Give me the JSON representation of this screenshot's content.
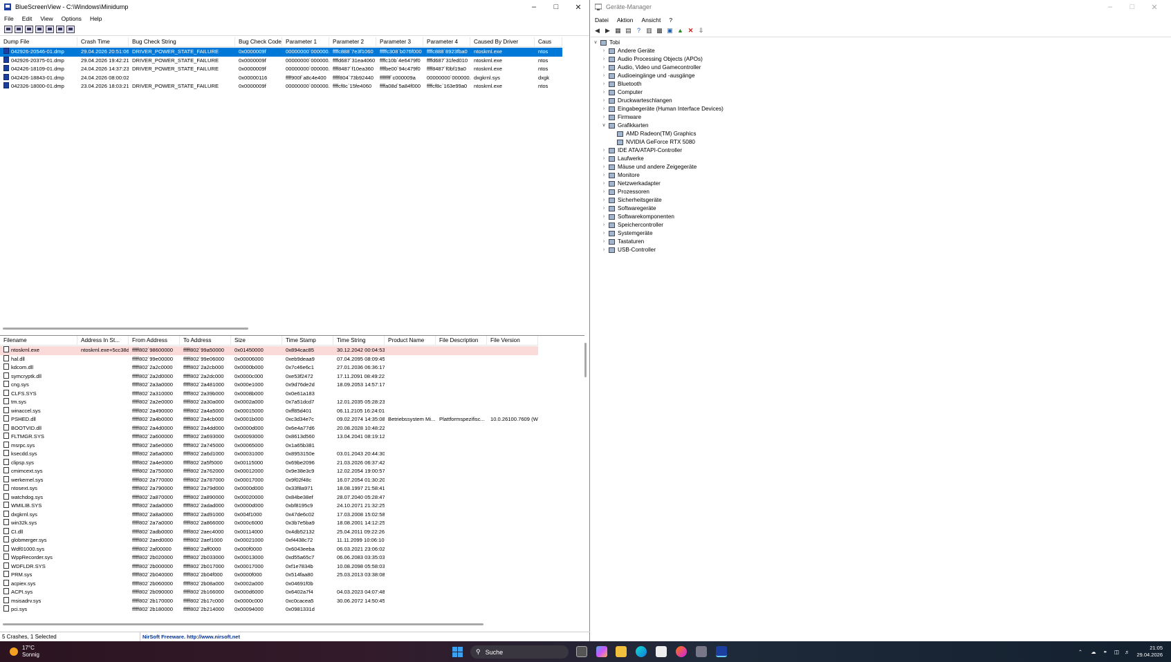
{
  "bsv": {
    "title": "BlueScreenView  -  C:\\Windows\\Minidump",
    "menu": [
      "File",
      "Edit",
      "View",
      "Options",
      "Help"
    ],
    "upper_columns": [
      "Dump File",
      "Crash Time",
      "Bug Check String",
      "Bug Check Code",
      "Parameter 1",
      "Parameter 2",
      "Parameter 3",
      "Parameter 4",
      "Caused By Driver",
      "Caus"
    ],
    "crashes": [
      [
        "042926-20546-01.dmp",
        "29.04.2026 20:51:06",
        "DRIVER_POWER_STATE_FAILURE",
        "0x0000009f",
        "00000000`000000...",
        "ffffc888`7e3f1060",
        "fffffc308`b076f000",
        "ffffc888`8923fba0",
        "ntoskrnl.exe",
        "ntos"
      ],
      [
        "042926-20375-01.dmp",
        "29.04.2026 19:42:21",
        "DRIVER_POWER_STATE_FAILURE",
        "0x0000009f",
        "00000000`000000...",
        "ffffd687`31ea4060",
        "ffffc10b`4e6479f0",
        "ffffd687`31fed010",
        "ntoskrnl.exe",
        "ntos"
      ],
      [
        "042426-18109-01.dmp",
        "24.04.2026 14:37:23",
        "DRIVER_POWER_STATE_FAILURE",
        "0x0000009f",
        "00000000`000000...",
        "ffff8487`f10ea360",
        "ffffbe00`94c479f0",
        "ffff8487`f0bf19a0",
        "ntoskrnl.exe",
        "ntos"
      ],
      [
        "042426-18843-01.dmp",
        "24.04.2026 08:00:02",
        "",
        "0x00000116",
        "ffff900f`a8c4e400",
        "fffff804`73b92440",
        "ffffffff`c000009a",
        "00000000`000000...",
        "dxgkrnl.sys",
        "dxgk"
      ],
      [
        "042326-18000-01.dmp",
        "23.04.2026 18:03:21",
        "DRIVER_POWER_STATE_FAILURE",
        "0x0000009f",
        "00000000`000000...",
        "ffffcf8c`15fe4060",
        "ffffa08d`5a84f000",
        "ffffcf8c`163e99a0",
        "ntoskrnl.exe",
        "ntos"
      ]
    ],
    "lower_columns": [
      "Filename",
      "Address In St...",
      "From Address",
      "To Address",
      "Size",
      "Time Stamp",
      "Time String",
      "Product Name",
      "File Description",
      "File Version"
    ],
    "modules": [
      [
        "ntoskrnl.exe",
        "ntoskrnl.exe+5cc38d",
        "fffff802`98600000",
        "fffff802`99a50000",
        "0x01450000",
        "0x894cac85",
        "30.12.2042 00:04:53",
        "",
        "",
        ""
      ],
      [
        "hal.dll",
        "",
        "fffff802`99e00000",
        "fffff802`99e06000",
        "0x00006000",
        "0xeb9deaa9",
        "07.04.2095 08:09:45",
        "",
        "",
        ""
      ],
      [
        "kdcom.dll",
        "",
        "fffff802`2a2c0000",
        "fffff802`2a2cb000",
        "0x0000b000",
        "0x7c46e6c1",
        "27.01.2036 06:36:17",
        "",
        "",
        ""
      ],
      [
        "symcryptk.dll",
        "",
        "fffff802`2a2d0000",
        "fffff802`2a2dc000",
        "0x0000c000",
        "0xe53f2472",
        "17.11.2091 08:49:22",
        "",
        "",
        ""
      ],
      [
        "cng.sys",
        "",
        "fffff802`2a3a0000",
        "fffff802`2a481000",
        "0x000e1000",
        "0x9d76de2d",
        "18.09.2053 14:57:17",
        "",
        "",
        ""
      ],
      [
        "CLFS.SYS",
        "",
        "fffff802`2a310000",
        "fffff802`2a39b000",
        "0x0008b000",
        "0x0e61a183",
        "",
        "",
        "",
        ""
      ],
      [
        "tm.sys",
        "",
        "fffff802`2a2e0000",
        "fffff802`2a30a000",
        "0x0002a000",
        "0x7a51dcd7",
        "12.01.2035 05:28:23",
        "",
        "",
        ""
      ],
      [
        "winaccel.sys",
        "",
        "fffff802`2a490000",
        "fffff802`2a4a5000",
        "0x00015000",
        "0xff85d401",
        "06.11.2105 16:24:01",
        "",
        "",
        ""
      ],
      [
        "PSHED.dll",
        "",
        "fffff802`2a4b0000",
        "fffff802`2a4cb000",
        "0x0001b000",
        "0xc3d34e7c",
        "09.02.2074 14:35:08",
        "Betriebssystem Mi...",
        "Plattformspezifisc...",
        "10.0.26100.7609 (W..."
      ],
      [
        "BOOTVID.dll",
        "",
        "fffff802`2a4d0000",
        "fffff802`2a4dd000",
        "0x0000d000",
        "0x6e4a77d6",
        "20.08.2028 10:48:22",
        "",
        "",
        ""
      ],
      [
        "FLTMGR.SYS",
        "",
        "fffff802`2a600000",
        "fffff802`2a693000",
        "0x00093000",
        "0x8613d560",
        "13.04.2041 08:19:12",
        "",
        "",
        ""
      ],
      [
        "msrpc.sys",
        "",
        "fffff802`2a6e0000",
        "fffff802`2a745000",
        "0x00065000",
        "0x1a65b381",
        "",
        "",
        "",
        ""
      ],
      [
        "ksecdd.sys",
        "",
        "fffff802`2a6a0000",
        "fffff802`2a6d1000",
        "0x00031000",
        "0x8953150e",
        "03.01.2043 20:44:30",
        "",
        "",
        ""
      ],
      [
        "clipsp.sys",
        "",
        "fffff802`2a4e0000",
        "fffff802`2a5f5000",
        "0x00115000",
        "0x69be2096",
        "21.03.2026 06:37:42",
        "",
        "",
        ""
      ],
      [
        "cmimcext.sys",
        "",
        "fffff802`2a750000",
        "fffff802`2a762000",
        "0x00012000",
        "0x9e38e3c9",
        "12.02.2054 19:00:57",
        "",
        "",
        ""
      ],
      [
        "werkernel.sys",
        "",
        "fffff802`2a770000",
        "fffff802`2a787000",
        "0x00017000",
        "0x9f02f48c",
        "16.07.2054 01:30:20",
        "",
        "",
        ""
      ],
      [
        "ntosext.sys",
        "",
        "fffff802`2a790000",
        "fffff802`2a79d000",
        "0x0000d000",
        "0x33f8a971",
        "18.08.1997 21:58:41",
        "",
        "",
        ""
      ],
      [
        "watchdog.sys",
        "",
        "fffff802`2a870000",
        "fffff802`2a890000",
        "0x00020000",
        "0x84be38ef",
        "28.07.2040 05:28:47",
        "",
        "",
        ""
      ],
      [
        "WMILIB.SYS",
        "",
        "fffff802`2ada0000",
        "fffff802`2adad000",
        "0x0000d000",
        "0xbf8195c9",
        "24.10.2071 21:32:25",
        "",
        "",
        ""
      ],
      [
        "dxgkrnl.sys",
        "",
        "fffff802`2a8a0000",
        "fffff802`2ad91000",
        "0x004f1000",
        "0x47de6c02",
        "17.03.2008 15:02:58",
        "",
        "",
        ""
      ],
      [
        "win32k.sys",
        "",
        "fffff802`2a7a0000",
        "fffff802`2a866000",
        "0x000c6000",
        "0x3b7e5ba9",
        "18.08.2001 14:12:25",
        "",
        "",
        ""
      ],
      [
        "CI.dll",
        "",
        "fffff802`2adb0000",
        "fffff802`2aec4000",
        "0x00114000",
        "0x4db52132",
        "25.04.2011 09:22:26",
        "",
        "",
        ""
      ],
      [
        "globmerger.sys",
        "",
        "fffff802`2aed0000",
        "fffff802`2aef1000",
        "0x00021000",
        "0xf4438c72",
        "11.11.2099 10:06:10",
        "",
        "",
        ""
      ],
      [
        "Wdf01000.sys",
        "",
        "fffff802`2af00000",
        "fffff802`2aff0000",
        "0x000f0000",
        "0x6043eeba",
        "06.03.2021 23:06:02",
        "",
        "",
        ""
      ],
      [
        "WppRecorder.sys",
        "",
        "fffff802`2b020000",
        "fffff802`2b033000",
        "0x00013000",
        "0xd55a65c7",
        "06.06.2083 03:35:03",
        "",
        "",
        ""
      ],
      [
        "WDFLDR.SYS",
        "",
        "fffff802`2b000000",
        "fffff802`2b017000",
        "0x00017000",
        "0xf1e7834b",
        "10.08.2098 05:58:03",
        "",
        "",
        ""
      ],
      [
        "PRM.sys",
        "",
        "fffff802`2b040000",
        "fffff802`2b04f000",
        "0x0000f000",
        "0x514faa80",
        "25.03.2013 03:38:08",
        "",
        "",
        ""
      ],
      [
        "acpiex.sys",
        "",
        "fffff802`2b060000",
        "fffff802`2b08a000",
        "0x0002a000",
        "0x04691f0b",
        "",
        "",
        "",
        ""
      ],
      [
        "ACPI.sys",
        "",
        "fffff802`2b090000",
        "fffff802`2b166000",
        "0x000d6000",
        "0x6402a7f4",
        "04.03.2023 04:07:48",
        "",
        "",
        ""
      ],
      [
        "msisadrv.sys",
        "",
        "fffff802`2b170000",
        "fffff802`2b17c000",
        "0x0000c000",
        "0xc0caceа5",
        "30.06.2072 14:50:45",
        "",
        "",
        ""
      ],
      [
        "pci.sys",
        "",
        "fffff802`2b180000",
        "fffff802`2b214000",
        "0x00094000",
        "0x0981331d",
        "",
        "",
        "",
        ""
      ]
    ],
    "status_left": "5 Crashes, 1 Selected",
    "status_right": "NirSoft Freeware.  http://www.nirsoft.net"
  },
  "dm": {
    "title": "Geräte-Manager",
    "menu": [
      "Datei",
      "Aktion",
      "Ansicht",
      "?"
    ],
    "root": "Tobi",
    "categories": [
      {
        "label": "Andere Geräte",
        "expanded": false
      },
      {
        "label": "Audio Processing Objects (APOs)",
        "expanded": false
      },
      {
        "label": "Audio, Video und Gamecontroller",
        "expanded": false
      },
      {
        "label": "Audioeingänge und -ausgänge",
        "expanded": false
      },
      {
        "label": "Bluetooth",
        "expanded": false
      },
      {
        "label": "Computer",
        "expanded": false
      },
      {
        "label": "Druckwarteschlangen",
        "expanded": false
      },
      {
        "label": "Eingabegeräte (Human Interface Devices)",
        "expanded": false
      },
      {
        "label": "Firmware",
        "expanded": false
      },
      {
        "label": "Grafikkarten",
        "expanded": true,
        "children": [
          "AMD Radeon(TM) Graphics",
          "NVIDIA GeForce RTX 5080"
        ]
      },
      {
        "label": "IDE ATA/ATAPI-Controller",
        "expanded": false
      },
      {
        "label": "Laufwerke",
        "expanded": false
      },
      {
        "label": "Mäuse und andere Zeigegeräte",
        "expanded": false
      },
      {
        "label": "Monitore",
        "expanded": false
      },
      {
        "label": "Netzwerkadapter",
        "expanded": false
      },
      {
        "label": "Prozessoren",
        "expanded": false
      },
      {
        "label": "Sicherheitsgeräte",
        "expanded": false
      },
      {
        "label": "Softwaregeräte",
        "expanded": false
      },
      {
        "label": "Softwarekomponenten",
        "expanded": false
      },
      {
        "label": "Speichercontroller",
        "expanded": false
      },
      {
        "label": "Systemgeräte",
        "expanded": false
      },
      {
        "label": "Tastaturen",
        "expanded": false
      },
      {
        "label": "USB-Controller",
        "expanded": false
      }
    ]
  },
  "taskbar": {
    "temperature": "17°C",
    "weather": "Sonnig",
    "search_placeholder": "Suche",
    "time": "21:05",
    "date": "29.04.2026"
  },
  "colors": {
    "selection": "#0078d7",
    "highlight_row": "#fbdada",
    "nirsoft_link": "#003399"
  }
}
